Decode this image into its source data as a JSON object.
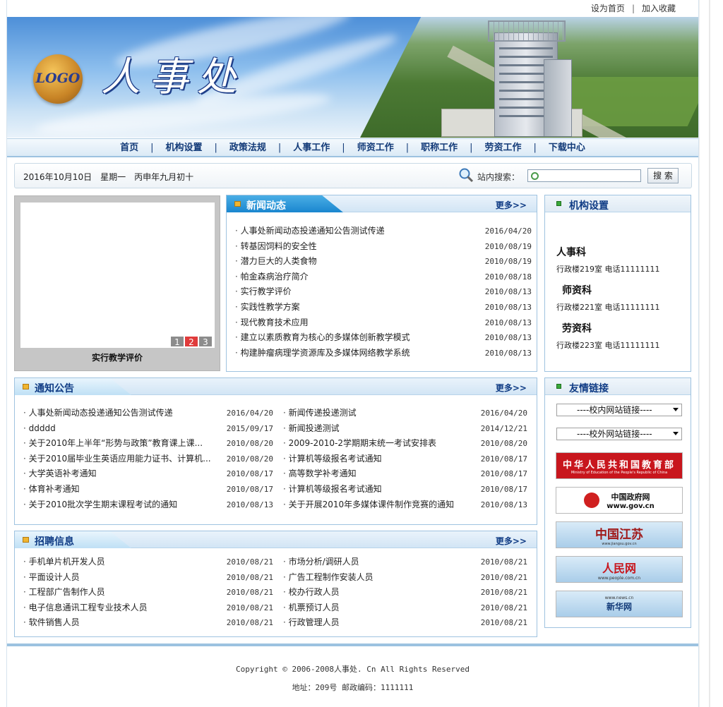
{
  "top_links": {
    "home": "设为首页",
    "sep": "|",
    "fav": "加入收藏"
  },
  "banner": {
    "logo": "LOGO",
    "title": "人事处"
  },
  "nav": [
    "首页",
    "机构设置",
    "政策法规",
    "人事工作",
    "师资工作",
    "职称工作",
    "劳资工作",
    "下载中心"
  ],
  "nav_sep": "|",
  "date_line": "2016年10月10日　星期一　丙申年九月初十",
  "search": {
    "label": "站内搜索：",
    "button": "搜 索",
    "value": ""
  },
  "slideshow": {
    "numbers": [
      "1",
      "2",
      "3"
    ],
    "active_index": 1,
    "caption": "实行教学评价"
  },
  "news": {
    "title": "新闻动态",
    "more": "更多>>",
    "items": [
      {
        "text": "人事处新闻动态投递通知公告测试传递",
        "date": "2016/04/20"
      },
      {
        "text": "转基因饲料的安全性",
        "date": "2010/08/19"
      },
      {
        "text": "潜力巨大的人类食物",
        "date": "2010/08/19"
      },
      {
        "text": "帕金森病治疗简介",
        "date": "2010/08/18"
      },
      {
        "text": "实行教学评价",
        "date": "2010/08/13"
      },
      {
        "text": "实践性教学方案",
        "date": "2010/08/13"
      },
      {
        "text": "现代教育技术应用",
        "date": "2010/08/13"
      },
      {
        "text": "建立以素质教育为核心的多媒体创新教学模式",
        "date": "2010/08/13"
      },
      {
        "text": "构建肿瘤病理学资源库及多媒体网络教学系统",
        "date": "2010/08/13"
      }
    ]
  },
  "org": {
    "title": "机构设置",
    "items": [
      {
        "name": "人事科",
        "info": "行政楼219室 电话11111111"
      },
      {
        "name": "师资科",
        "info": "行政楼221室 电话11111111"
      },
      {
        "name": "劳资科",
        "info": "行政楼223室 电话11111111"
      }
    ]
  },
  "notice": {
    "title": "通知公告",
    "more": "更多>>",
    "left": [
      {
        "text": "人事处新闻动态投递通知公告测试传递",
        "date": "2016/04/20"
      },
      {
        "text": "ddddd",
        "date": "2015/09/17"
      },
      {
        "text": "关于2010年上半年“形势与政策”教育课上课...",
        "date": "2010/08/20"
      },
      {
        "text": "关于2010届毕业生英语应用能力证书、计算机...",
        "date": "2010/08/20"
      },
      {
        "text": "大学英语补考通知",
        "date": "2010/08/17"
      },
      {
        "text": "体育补考通知",
        "date": "2010/08/17"
      },
      {
        "text": "关于2010批次学生期末课程考试的通知",
        "date": "2010/08/13"
      }
    ],
    "right": [
      {
        "text": "新闻传递投递测试",
        "date": "2016/04/20"
      },
      {
        "text": "新闻投递测试",
        "date": "2014/12/21"
      },
      {
        "text": "2009-2010-2学期期末统一考试安排表",
        "date": "2010/08/20"
      },
      {
        "text": "计算机等级报名考试通知",
        "date": "2010/08/17"
      },
      {
        "text": "高等数学补考通知",
        "date": "2010/08/17"
      },
      {
        "text": "计算机等级报名考试通知",
        "date": "2010/08/17"
      },
      {
        "text": "关于开展2010年多媒体课件制作竞赛的通知",
        "date": "2010/08/13"
      }
    ]
  },
  "jobs": {
    "title": "招聘信息",
    "more": "更多>>",
    "left": [
      {
        "text": "手机单片机开发人员",
        "date": "2010/08/21"
      },
      {
        "text": "平面设计人员",
        "date": "2010/08/21"
      },
      {
        "text": "工程部广告制作人员",
        "date": "2010/08/21"
      },
      {
        "text": "电子信息通讯工程专业技术人员",
        "date": "2010/08/21"
      },
      {
        "text": "软件销售人员",
        "date": "2010/08/21"
      }
    ],
    "right": [
      {
        "text": "市场分析/调研人员",
        "date": "2010/08/21"
      },
      {
        "text": "广告工程制作安装人员",
        "date": "2010/08/21"
      },
      {
        "text": "校办行政人员",
        "date": "2010/08/21"
      },
      {
        "text": "机票预订人员",
        "date": "2010/08/21"
      },
      {
        "text": "行政管理人员",
        "date": "2010/08/21"
      }
    ]
  },
  "links": {
    "title": "友情链接",
    "select_inner": "----校内网站链接----",
    "select_outer": "----校外网站链接----",
    "logos": [
      {
        "name": "中华人民共和国教育部",
        "sub": "Ministry of Education of the People's Republic of China",
        "color": "#c8161d"
      },
      {
        "name": "中国政府网",
        "sub": "www.gov.cn",
        "color": "#ffffff"
      },
      {
        "name": "中国江苏",
        "sub": "www.jiangsu.gov.cn",
        "color": "#bcd8ee"
      },
      {
        "name": "人民网",
        "sub": "www.people.com.cn",
        "color": "#bcd8ee"
      },
      {
        "name": "新华网",
        "sub": "www.news.cn",
        "color": "#bcd8ee"
      }
    ]
  },
  "footer": {
    "line1": "Copyright © 2006-2008人事处. Cn All Rights Reserved",
    "line2": "地址：209号 邮政编码：1111111"
  }
}
